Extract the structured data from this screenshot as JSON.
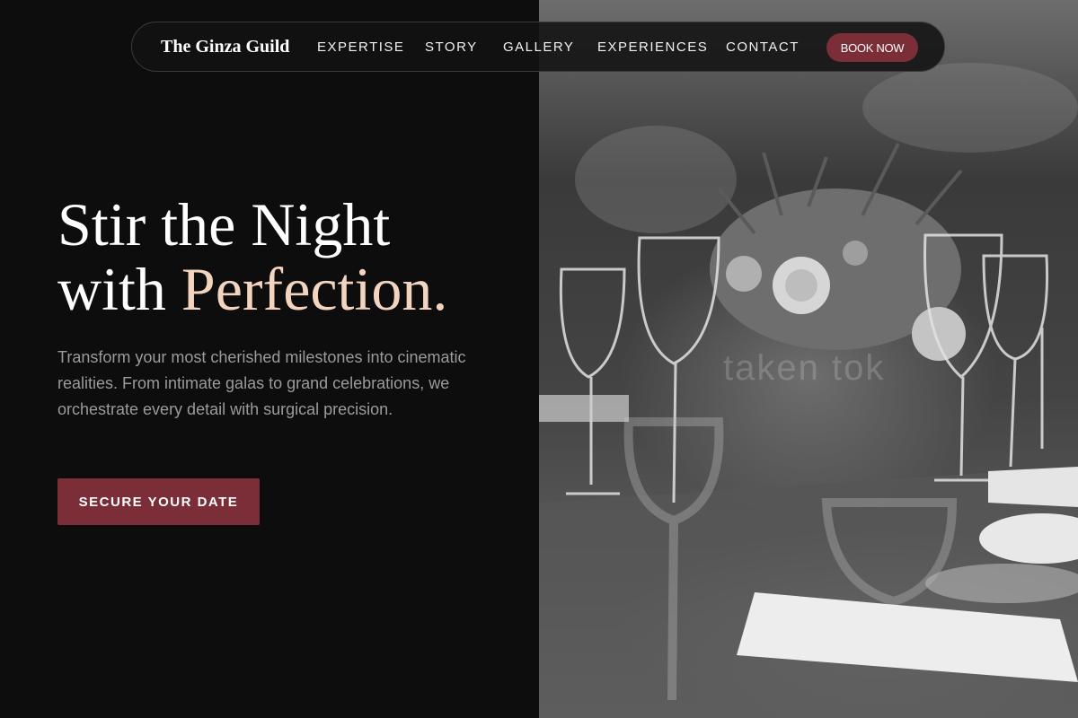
{
  "nav": {
    "brand": "The Ginza Guild",
    "links": [
      "EXPERTISE",
      "STORY",
      "GALLERY",
      "EXPERIENCES",
      "CONTACT"
    ],
    "cta_label": "BOOK NOW"
  },
  "hero": {
    "title_line1": "Stir the Night",
    "title_line2_prefix": "with ",
    "title_line2_accent": "Perfection.",
    "description": "Transform your most cherished milestones into cinematic realities. From intimate galas to grand celebrations, we orchestrate every detail with surgical precision.",
    "cta_label": "SECURE YOUR DATE"
  },
  "photo": {
    "subject": "grayscale-table-setting",
    "watermark": "taken tok"
  },
  "colors": {
    "background": "#0d0d0d",
    "accent_burgundy": "#7b2d38",
    "accent_peach": "#f3d5bf",
    "muted_text": "#9b9b9b"
  }
}
